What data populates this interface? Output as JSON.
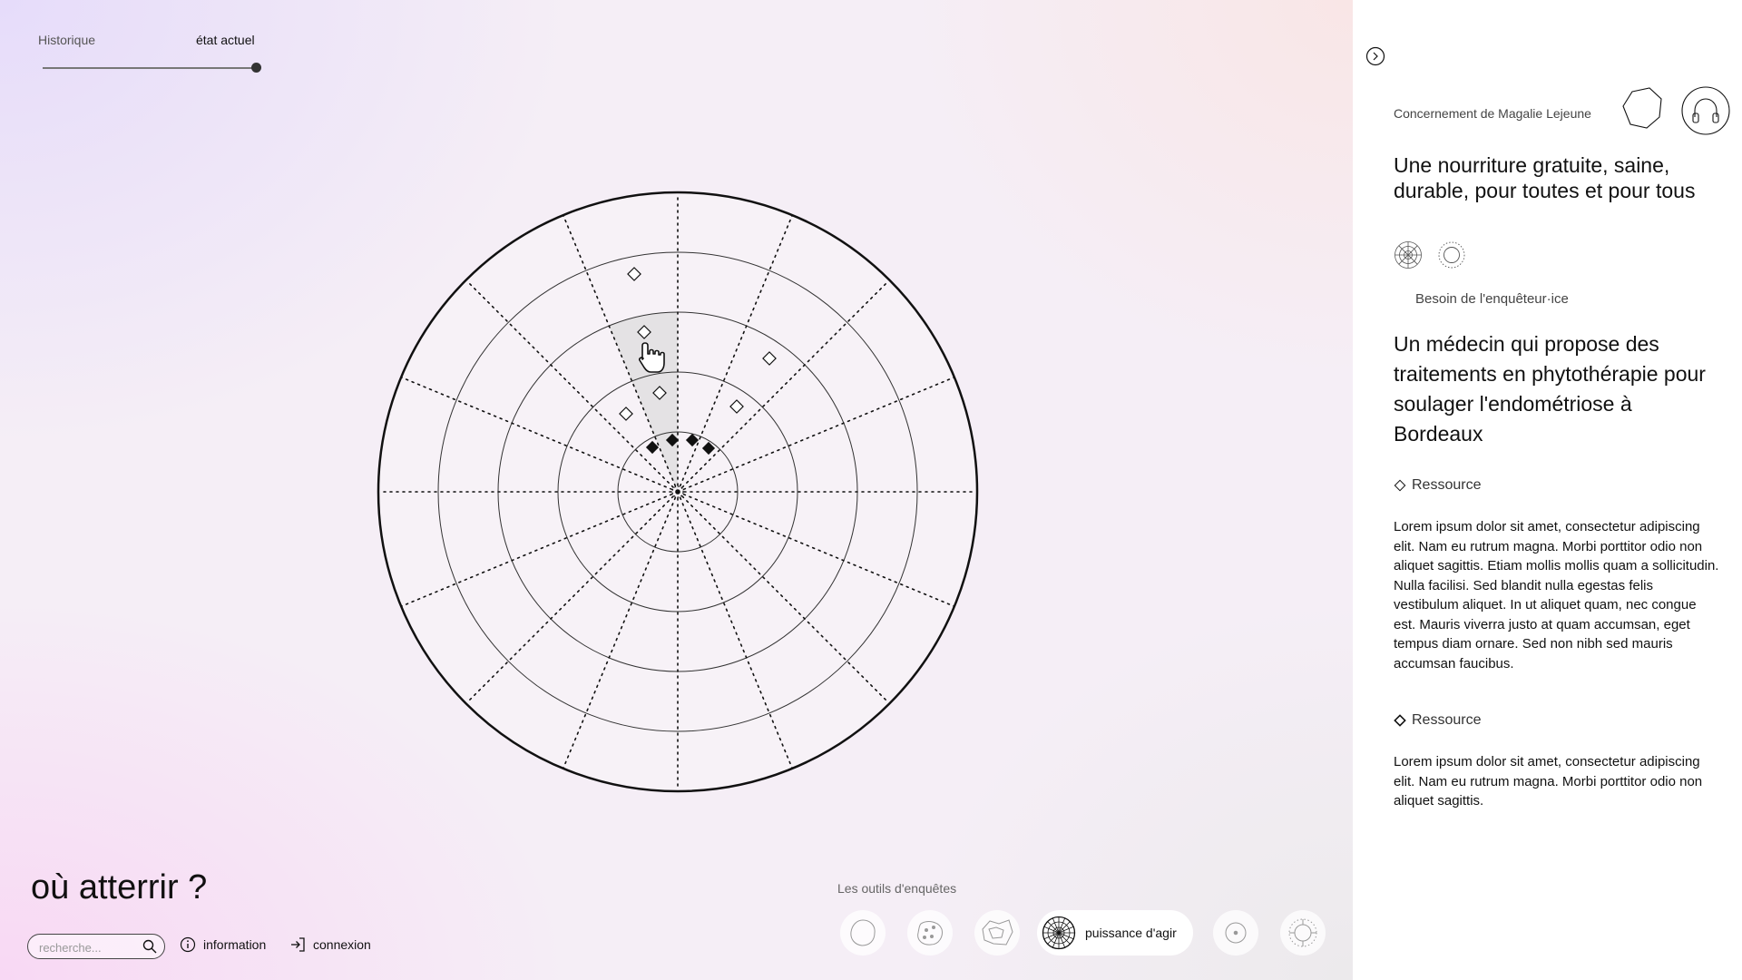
{
  "timeline": {
    "past_label": "Historique",
    "current_label": "état actuel"
  },
  "app": {
    "title": "où atterrir ?"
  },
  "search": {
    "placeholder": "recherche..."
  },
  "nav": {
    "info_label": "information",
    "login_label": "connexion"
  },
  "tools": {
    "section_label": "Les outils d'enquêtes",
    "active_label": "puissance d'agir"
  },
  "panel": {
    "concern_label": "Concernement de Magalie Lejeune",
    "title": "Une nourriture gratuite, saine, durable, pour toutes et pour tous",
    "need_label": "Besoin de l'enquêteur·ice",
    "need_text": "Un médecin qui propose des traitements en phytothérapie pour soulager l'endométriose à Bordeaux",
    "resources": [
      {
        "label": "Ressource",
        "text": "Lorem ipsum dolor sit amet, consectetur adipiscing elit. Nam eu rutrum magna. Morbi porttitor odio non aliquet sagittis. Etiam mollis mollis quam a sollicitudin. Nulla facilisi. Sed blandit nulla egestas felis vestibulum aliquet. In ut aliquet quam, nec congue est. Mauris viverra justo at quam accumsan, eget tempus diam ornare. Sed non nibh sed mauris accumsan faucibus."
      },
      {
        "label": "Ressource",
        "text": "Lorem ipsum dolor sit amet, consectetur adipiscing elit. Nam eu rutrum magna. Morbi porttitor odio non aliquet sagittis."
      }
    ]
  },
  "colors": {
    "highlight_sector": "#e4e2e4",
    "disc_fill": "#f7f2f7",
    "ink": "#111111"
  }
}
